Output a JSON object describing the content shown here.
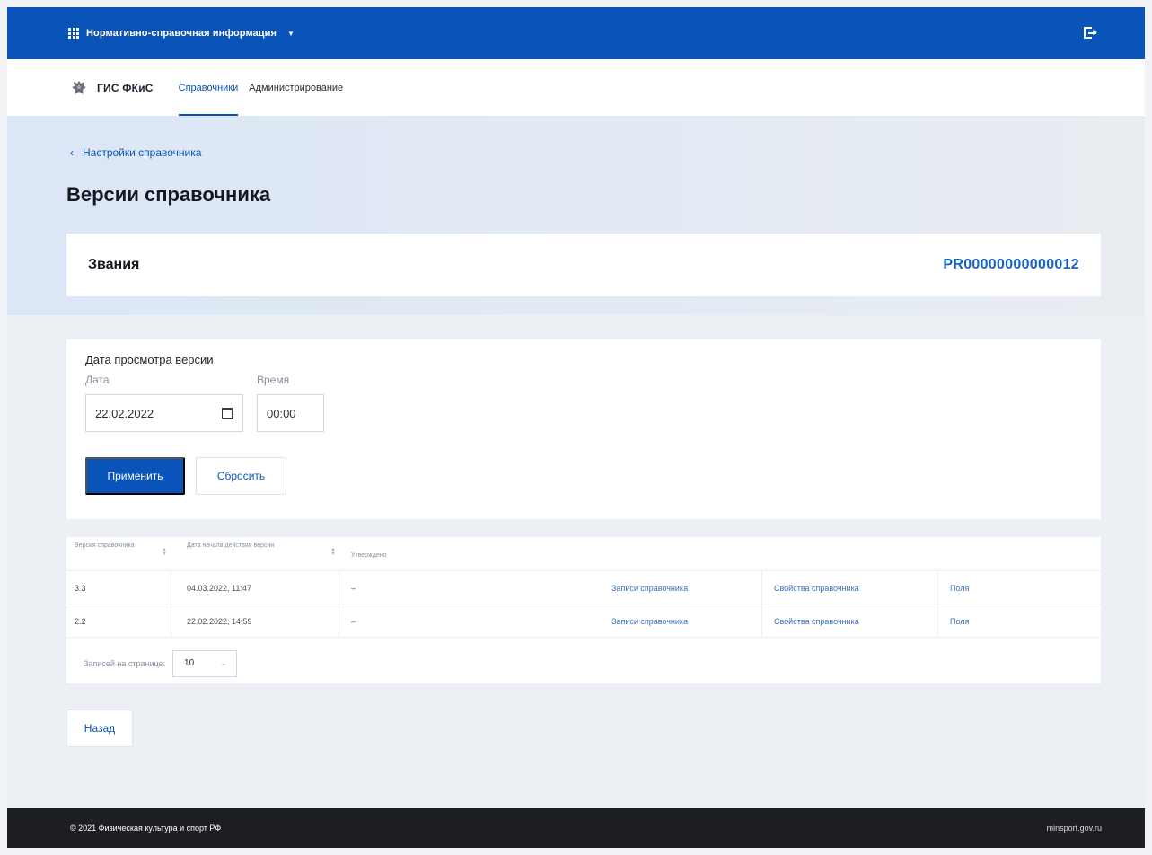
{
  "topbar": {
    "app_name": "Нормативно-справочная информация",
    "menu_icon": "grid-icon",
    "caret_icon": "chevron-down-icon",
    "logout_icon": "logout-icon",
    "color": "#0a53b8"
  },
  "navbar": {
    "brand": "ГИС ФКиС",
    "emblem_icon": "emblem-eagle-icon",
    "items": [
      {
        "label": "Справочники",
        "active": true
      },
      {
        "label": "Администрирование",
        "active": false
      }
    ]
  },
  "breadcrumb": {
    "back_label": "Настройки справочника"
  },
  "page": {
    "title": "Версии справочника"
  },
  "dictionary": {
    "name": "Звания",
    "code": "PR00000000000012"
  },
  "filter": {
    "heading": "Дата просмотра версии",
    "date_label": "Дата",
    "date_value": "22.02.2022",
    "time_label": "Время",
    "time_value": "00:00",
    "apply_label": "Применить",
    "reset_label": "Сбросить"
  },
  "table": {
    "columns": [
      {
        "label": "Версия справочника",
        "sortable": true
      },
      {
        "label": "Дата начала действия версии",
        "sortable": true
      },
      {
        "label": "Утверждено",
        "sortable": false
      }
    ],
    "rows": [
      {
        "version": "3.3",
        "date": "04.03.2022, 11:47",
        "approved": "–",
        "records": "Записи справочника",
        "properties": "Свойства справочника",
        "fields": "Поля"
      },
      {
        "version": "2.2",
        "date": "22.02.2022, 14:59",
        "approved": "–",
        "records": "Записи справочника",
        "properties": "Свойства справочника",
        "fields": "Поля"
      }
    ],
    "pager": {
      "label": "Записей на странице:",
      "value": "10"
    }
  },
  "actions": {
    "back_label": "Назад"
  },
  "footer": {
    "copyright": "© 2021 Физическая культура и спорт РФ",
    "site": "minsport.gov.ru"
  }
}
